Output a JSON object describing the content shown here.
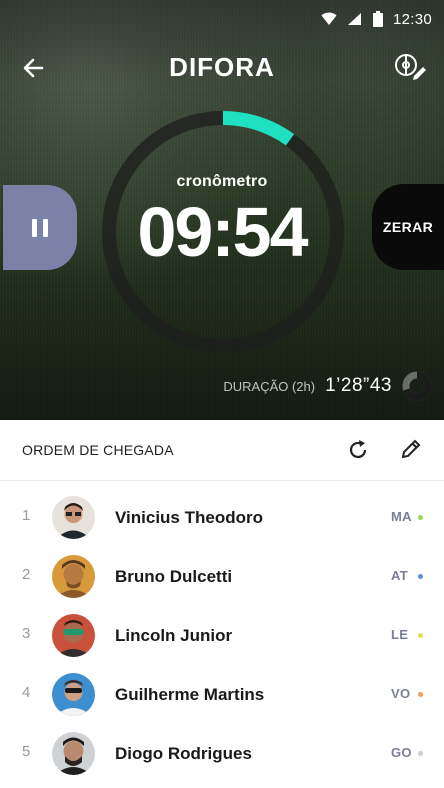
{
  "statusbar": {
    "time": "12:30"
  },
  "app": {
    "logo": "DIFORA"
  },
  "timer": {
    "label": "cronômetro",
    "value": "09:54",
    "progress": 0.1,
    "accent": "#1fe0c1"
  },
  "controls": {
    "reset_label": "ZERAR",
    "pause_icon": "pause-icon"
  },
  "duration": {
    "label": "DURAÇÃO (2h)",
    "value": "1’28”43",
    "progress": 0.7
  },
  "list": {
    "title": "ORDEM DE CHEGADA",
    "players": [
      {
        "rank": "1",
        "name": "Vinicius Theodoro",
        "position": "MA",
        "dot_color": "#9bd35a"
      },
      {
        "rank": "2",
        "name": "Bruno Dulcetti",
        "position": "AT",
        "dot_color": "#5c8fd6"
      },
      {
        "rank": "3",
        "name": "Lincoln Junior",
        "position": "LE",
        "dot_color": "#e1e05c"
      },
      {
        "rank": "4",
        "name": "Guilherme Martins",
        "position": "VO",
        "dot_color": "#f0a060"
      },
      {
        "rank": "5",
        "name": "Diogo Rodrigues",
        "position": "GO",
        "dot_color": "#cfcfcf"
      }
    ]
  }
}
